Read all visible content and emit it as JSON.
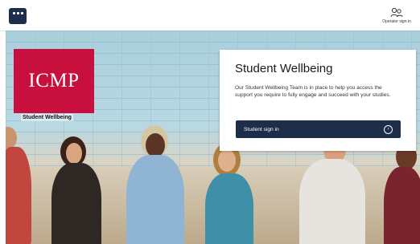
{
  "header": {
    "menu_icon": "grid-menu-icon",
    "operator_icon": "users-key-icon",
    "operator_label": "Operator sign in"
  },
  "hero": {
    "logo_text": "ICMP",
    "logo_subtitle": "Student Wellbeing",
    "brand_color": "#c8103e"
  },
  "card": {
    "title": "Student Wellbeing",
    "body": "Our Student Wellbeing Team is in place to help you access the support you require to fully engage and succeed with your studies.",
    "button_label": "Student sign in",
    "button_icon": "arrow-right-circle-icon",
    "button_color": "#1c2e4a"
  }
}
